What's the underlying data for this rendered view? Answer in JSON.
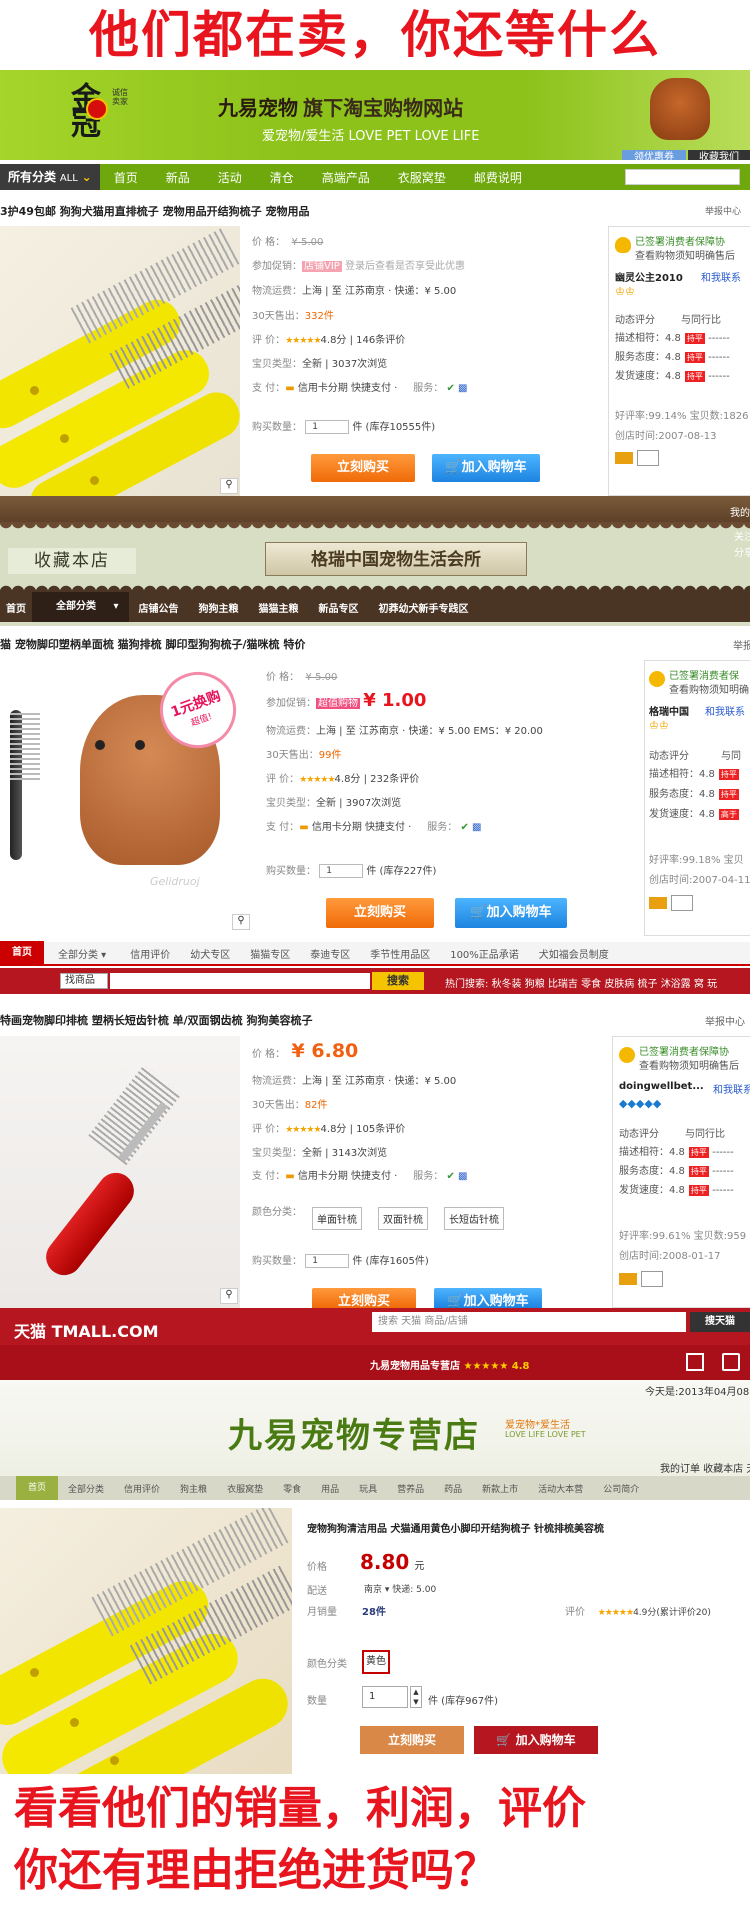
{
  "top_banner": "他们都在卖，你还等什么",
  "bottom_banner_1": "看看他们的销量，利润，评价",
  "bottom_banner_2": "你还有理由拒绝进货吗？",
  "store1": {
    "logo_text": "金冠",
    "logo_badge": "诚信卖家",
    "logo_sub": "皇冠",
    "site_title": "九易宠物",
    "site_title_2": "旗下淘宝购物网站",
    "slogan": "爱宠物/爱生活 LOVE PET LOVE LIFE",
    "btn_coupon": "领优惠券",
    "btn_fav": "收藏我们",
    "nav": [
      "所有分类",
      "ALL",
      "首页",
      "新品",
      "活动",
      "清仓",
      "高端产品",
      "衣服窝垫",
      "邮费说明"
    ],
    "product_title": "3护49包邮 狗狗犬猫用直排梳子 宠物用品开结狗梳子 宠物用品",
    "price_label": "价  格：",
    "price": "¥ 5.00",
    "promo_label": "参加促销：",
    "promo_tag": "店铺VIP",
    "promo_text": "登录后查看是否享受此优惠",
    "ship_label": "物流运费：",
    "ship": "上海 | 至 江苏南京 ·   快递：¥ 5.00",
    "sold_label": "30天售出：",
    "sold": "332件",
    "rate_label": "评  价：",
    "rating": "★★★★★",
    "rating_text": "4.8分  |  146条评价",
    "type_label": "宝贝类型：",
    "type": "全新  |  3037次浏览",
    "pay_label": "支  付：",
    "pay": "信用卡分期   快捷支付  ·",
    "service_label": "服务：",
    "qty_label": "购买数量：",
    "qty": "1",
    "stock": "件 (库存10555件)",
    "buy": "立刻购买",
    "cart": "加入购物车",
    "report": "举报中心",
    "side_title": "已签署消费者保障协",
    "side_sub": "查看购物须知明确售后",
    "shop_name": "幽灵公主2010",
    "side_contact": "和我联系",
    "side_score": "动态评分",
    "side_compare": "与同行比",
    "scores": [
      {
        "label": "描述相符：4.8",
        "tag": "持平"
      },
      {
        "label": "服务态度：4.8",
        "tag": "持平"
      },
      {
        "label": "发货速度：4.8",
        "tag": "持平"
      }
    ],
    "side_good": "好评率:99.14%  宝贝数:1826",
    "side_date": "创店时间:2007-08-13"
  },
  "store2": {
    "fav": "收藏本店",
    "name": "格瑞中国宠物生活会所",
    "right": [
      "我的",
      "关注",
      "分享"
    ],
    "nav": [
      "首页",
      "全部分类",
      "店铺公告",
      "狗狗主粮",
      "猫猫主粮",
      "新品专区",
      "初莽幼犬新手专践区"
    ],
    "product_title": "猫 宠物脚印塑柄单面梳 猫狗排梳 脚印型狗狗梳子/猫咪梳 特价",
    "price_label": "价  格：",
    "price": "¥ 5.00",
    "promo_label": "参加促销：",
    "promo_tag": "超值购物",
    "promo_price": "¥ 1.00",
    "ship_label": "物流运费：",
    "ship": "上海 | 至 江苏南京 ·   快递：¥ 5.00    EMS：¥ 20.00",
    "sold_label": "30天售出：",
    "sold": "99件",
    "rate_label": "评  价：",
    "rating": "★★★★★",
    "rating_text": "4.8分  |  232条评价",
    "type_label": "宝贝类型：",
    "type": "全新  |  3907次浏览",
    "pay_label": "支  付：",
    "pay": "信用卡分期   快捷支付  ·",
    "service_label": "服务：",
    "qty_label": "购买数量：",
    "qty": "1",
    "stock": "件 (库存227件)",
    "buy": "立刻购买",
    "cart": "加入购物车",
    "report": "举报",
    "badge": "1元换购",
    "badge_sub": "超值!",
    "watermark": "Gelidruoj",
    "side_title": "已签署消费者保",
    "side_sub": "查看购物须知明确",
    "shop_name": "格瑞中国",
    "side_contact": "和我联系",
    "side_score": "动态评分",
    "side_compare": "与同",
    "scores": [
      {
        "label": "描述相符：4.8",
        "tag": "持平"
      },
      {
        "label": "服务态度：4.8",
        "tag": "持平"
      },
      {
        "label": "发货速度：4.8",
        "tag": "高于"
      }
    ],
    "side_good": "好评率:99.18%  宝贝",
    "side_date": "创店时间:2007-04-11"
  },
  "store3": {
    "nav": [
      "首页",
      "全部分类",
      "信用评价",
      "幼犬专区",
      "猫猫专区",
      "泰迪专区",
      "季节性用品区",
      "100%正品承诺",
      "犬如福会员制度"
    ],
    "search_scope": "找商品",
    "search_btn": "搜索",
    "hot_label": "热门搜索:",
    "hot": [
      "秋冬装",
      "狗粮",
      "比瑞吉",
      "零食",
      "皮肤病",
      "梳子",
      "沐浴露",
      "窝",
      "玩"
    ],
    "product_title": "特画宠物脚印排梳 塑柄长短齿针梳 单/双面钢齿梳 狗狗美容梳子",
    "price_label": "价  格：",
    "price": "¥ 6.80",
    "ship_label": "物流运费：",
    "ship": "上海 | 至 江苏南京 ·   快递：¥ 5.00",
    "sold_label": "30天售出：",
    "sold": "82件",
    "rate_label": "评  价：",
    "rating": "★★★★★",
    "rating_text": "4.8分  |  105条评价",
    "type_label": "宝贝类型：",
    "type": "全新  |  3143次浏览",
    "pay_label": "支  付：",
    "pay": "信用卡分期   快捷支付  ·",
    "service_label": "服务：",
    "color_label": "颜色分类：",
    "colors": [
      "单面针梳",
      "双面针梳",
      "长短齿针梳"
    ],
    "qty_label": "购买数量：",
    "qty": "1",
    "stock": "件 (库存1605件)",
    "buy": "立刻购买",
    "cart": "加入购物车",
    "report": "举报中心",
    "side_title": "已签署消费者保障协",
    "side_sub": "查看购物须知明确售后",
    "shop_name": "doingwellbet...",
    "side_contact": "和我联系",
    "side_score": "动态评分",
    "side_compare": "与同行比",
    "scores": [
      {
        "label": "描述相符：4.8",
        "tag": "持平"
      },
      {
        "label": "服务态度：4.8",
        "tag": "持平"
      },
      {
        "label": "发货速度：4.8",
        "tag": "持平"
      }
    ],
    "side_good": "好评率:99.61%  宝贝数:959",
    "side_date": "创店时间:2008-01-17"
  },
  "store4": {
    "tmall": "天猫 TMALL.COM",
    "search_placeholder": "搜索 天猫 商品/店铺",
    "search_btn": "搜天猫",
    "shop_bar": "九易宠物用品专营店",
    "shop_rating": "★★★★★ 4.8",
    "date": "今天是:2013年04月08日",
    "store_name": "九易宠物专营店",
    "store_slogan": "爱宠物*爱生活",
    "store_slogan_en": "LOVE LIFE LOVE PET",
    "top_links": "我的订单  收藏本店  天",
    "nav": [
      "首页",
      "全部分类",
      "信用评价",
      "狗主粮",
      "衣服窝垫",
      "零食",
      "用品",
      "玩具",
      "营养品",
      "药品",
      "新款上市",
      "活动大本营",
      "公司简介"
    ],
    "product_title": "宠物狗狗清洁用品 犬猫通用黄色小脚印开结狗梳子 针梳排梳美容梳",
    "price_label": "价格",
    "price": "8.80",
    "price_unit": "元",
    "ship_label": "配送",
    "ship": "南京 ▾   快递: 5.00",
    "sold_label": "月销量",
    "sold": "28件",
    "rate_label": "评价",
    "rating": "★★★★★",
    "rating_text": "4.9分(累计评价20)",
    "color_label": "颜色分类",
    "color": "黄色",
    "qty_label": "数量",
    "qty": "1",
    "stock": "件 (库存967件)",
    "buy": "立刻购买",
    "cart": "加入购物车"
  },
  "colors": {
    "red": "#e8141e",
    "green": "#8cc21a",
    "orange": "#f07a10",
    "blue": "#1d84e0",
    "brown": "#4a3a2a",
    "tmall_red": "#b5161f"
  }
}
